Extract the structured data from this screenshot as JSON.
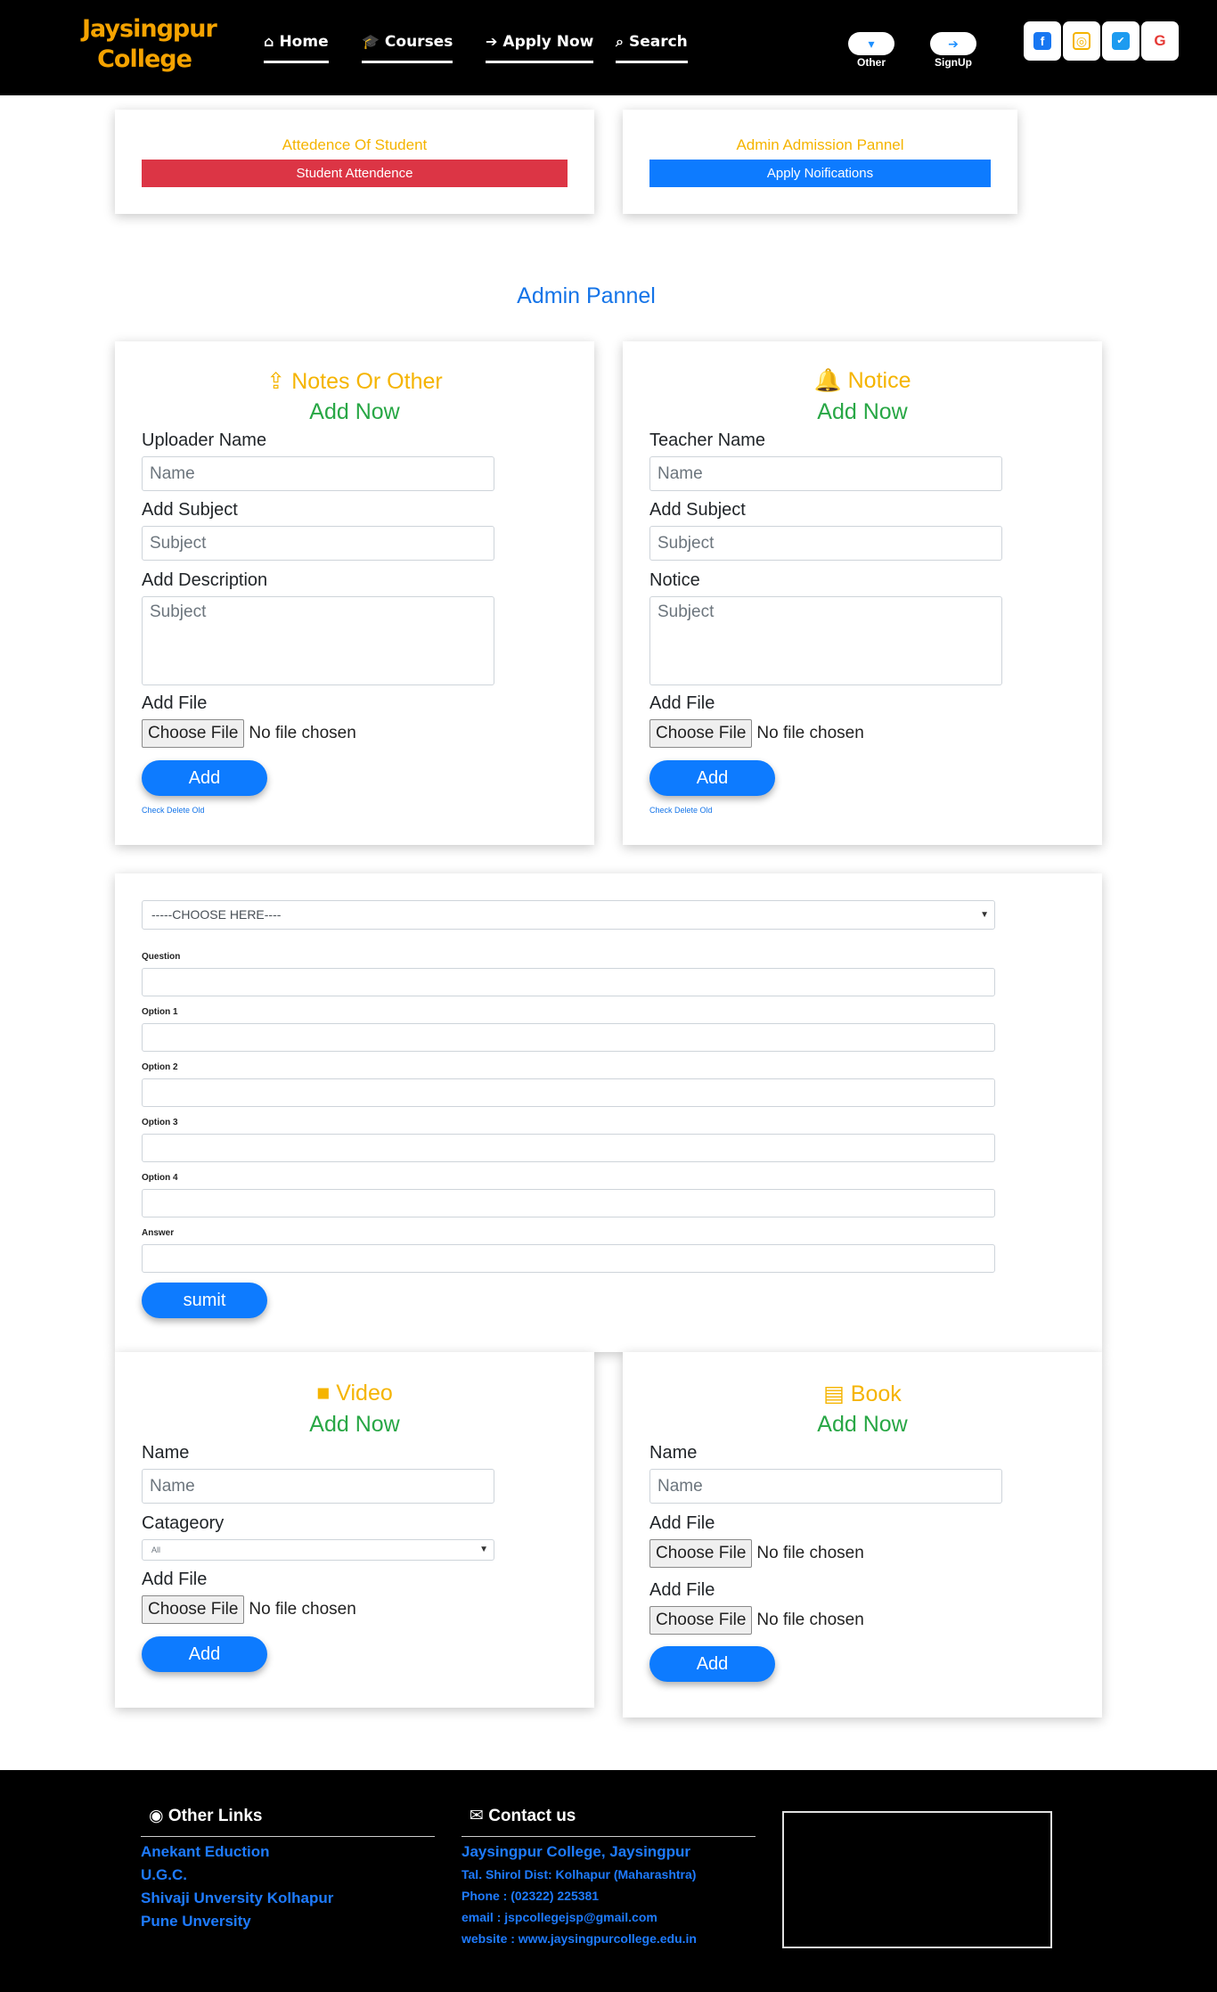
{
  "header": {
    "brand_line1": "Jaysingpur",
    "brand_line2": "College",
    "nav": [
      {
        "label": "Home",
        "icon": "home-icon"
      },
      {
        "label": "Courses",
        "icon": "graduation-cap-icon"
      },
      {
        "label": "Apply Now",
        "icon": "arrow-right-icon"
      },
      {
        "label": "Search",
        "icon": "search-icon"
      }
    ],
    "other_label": "Other",
    "signup_label": "SignUp",
    "social": [
      {
        "icon": "facebook-icon",
        "color": "#1877f2"
      },
      {
        "icon": "instagram-icon",
        "color": "#f5b400"
      },
      {
        "icon": "twitter-icon",
        "color": "#1d9bf0"
      },
      {
        "icon": "google-icon",
        "color": "#e53935"
      }
    ]
  },
  "top_cards": {
    "attendance": {
      "title": "Attedence Of Student",
      "button": "Student Attendence",
      "button_color": "#dc3545"
    },
    "admission": {
      "title": "Admin Admission Pannel",
      "button": "Apply Noifications",
      "button_color": "#0d7bff"
    }
  },
  "section_title": "Admin Pannel",
  "notes_card": {
    "title": "Notes Or Other",
    "subtitle": "Add Now",
    "label_name": "Uploader Name",
    "placeholder_name": "Name",
    "label_subject": "Add Subject",
    "placeholder_subject": "Subject",
    "label_desc": "Add Description",
    "placeholder_desc": "Subject",
    "label_file": "Add File",
    "file_button": "Choose File",
    "file_status": "No file chosen",
    "add_button": "Add",
    "link": "Check Delete Old"
  },
  "notice_card": {
    "title": "Notice",
    "subtitle": "Add Now",
    "label_name": "Teacher Name",
    "placeholder_name": "Name",
    "label_subject": "Add Subject",
    "placeholder_subject": "Subject",
    "label_desc": "Notice",
    "placeholder_desc": "Subject",
    "label_file": "Add File",
    "file_button": "Choose File",
    "file_status": "No file chosen",
    "add_button": "Add",
    "link": "Check Delete Old"
  },
  "quiz_card": {
    "select": "-----CHOOSE HERE----",
    "labels": [
      "Question",
      "Option 1",
      "Option 2",
      "Option 3",
      "Option 4",
      "Answer"
    ],
    "submit": "sumit"
  },
  "video_card": {
    "title": "Video",
    "subtitle": "Add Now",
    "label_name": "Name",
    "placeholder_name": "Name",
    "label_category": "Catageory",
    "category_value": "All",
    "label_file": "Add File",
    "file_button": "Choose File",
    "file_status": "No file chosen",
    "add_button": "Add"
  },
  "book_card": {
    "title": "Book",
    "subtitle": "Add Now",
    "label_name": "Name",
    "placeholder_name": "Name",
    "label_file1": "Add File",
    "label_file2": "Add File",
    "file_button": "Choose File",
    "file_status": "No file chosen",
    "add_button": "Add"
  },
  "footer": {
    "links_title": "Other Links",
    "links": [
      "Anekant Eduction",
      "U.G.C.",
      "Shivaji Unversity Kolhapur",
      "Pune Unversity"
    ],
    "contact_title": "Contact us",
    "contact_name": "Jaysingpur College, Jaysingpur",
    "contact_address": "Tal. Shirol Dist: Kolhapur (Maharashtra)",
    "contact_phone": "Phone : (02322) 225381",
    "contact_email": "email : jspcollegejsp@gmail.com",
    "contact_website": "website : www.jaysingpurcollege.edu.in"
  }
}
